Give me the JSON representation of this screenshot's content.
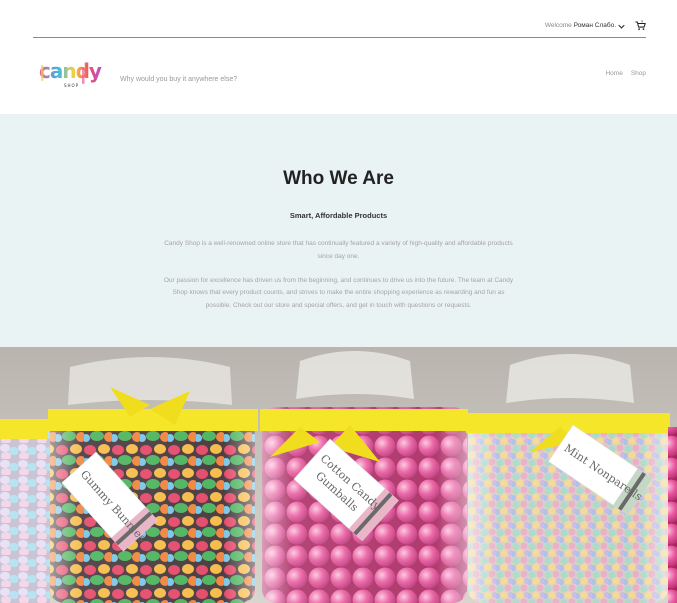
{
  "topbar": {
    "welcome_label": "Welcome",
    "user_name": "Роман Слабо.",
    "cart_count": "0"
  },
  "header": {
    "logo_text": "candy",
    "logo_subtext": "SHOP",
    "tagline": "Why would you buy it anywhere else?",
    "nav": {
      "home": "Home",
      "shop": "Shop"
    }
  },
  "about": {
    "title": "Who We Are",
    "subtitle": "Smart, Affordable Products",
    "paragraph1": "Candy Shop is a well-renowned online store that has continually featured a variety of high-quality and affordable products since day one.",
    "paragraph2": "Our passion for excellence has driven us from the beginning, and continues to drive us into the future. The team at Candy Shop knows that every product counts, and strives to make the entire shopping experience as rewarding and fun as possible. Check out our store and special offers, and get in touch with questions or requests."
  },
  "hero": {
    "jars": [
      {
        "label": "Gummy Bunnies"
      },
      {
        "label_line1": "Cotton Candy",
        "label_line2": "Gumballs"
      },
      {
        "label": "Mint Nonpareils"
      }
    ]
  },
  "colors": {
    "about_bg": "#eaf3f3",
    "ribbon": "#f5e62a",
    "gumball_pink": "#e9579e"
  }
}
